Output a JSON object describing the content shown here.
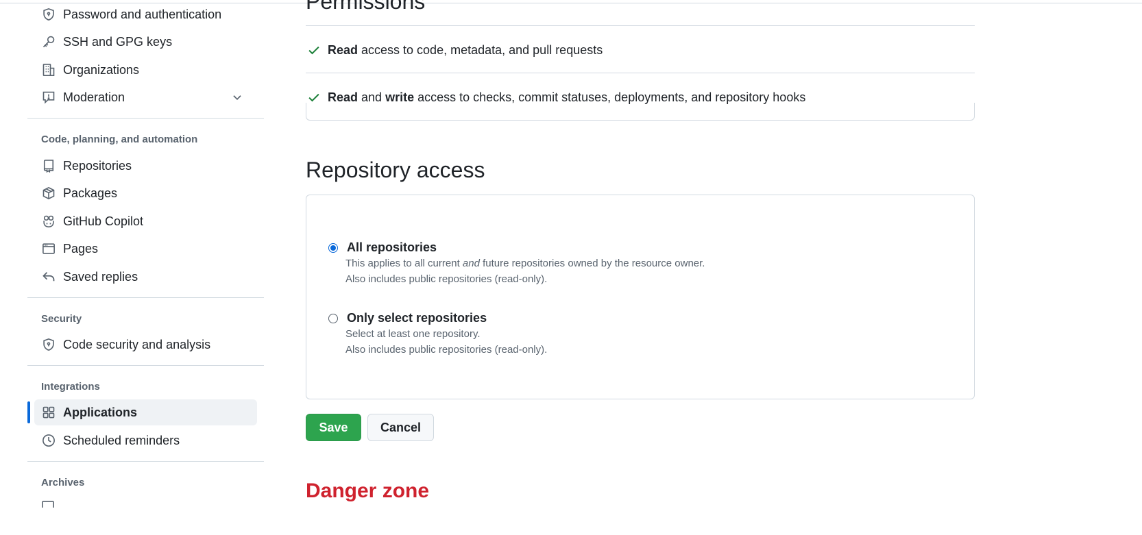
{
  "sidebar": {
    "items_top": [
      {
        "label": "Password and authentication",
        "icon": "shield-lock-icon"
      },
      {
        "label": "SSH and GPG keys",
        "icon": "key-icon"
      },
      {
        "label": "Organizations",
        "icon": "organization-icon"
      },
      {
        "label": "Moderation",
        "icon": "report-icon",
        "expandable": true
      }
    ],
    "sections": [
      {
        "title": "Code, planning, and automation",
        "items": [
          {
            "label": "Repositories",
            "icon": "repo-icon"
          },
          {
            "label": "Packages",
            "icon": "package-icon"
          },
          {
            "label": "GitHub Copilot",
            "icon": "copilot-icon"
          },
          {
            "label": "Pages",
            "icon": "browser-icon"
          },
          {
            "label": "Saved replies",
            "icon": "reply-icon"
          }
        ]
      },
      {
        "title": "Security",
        "items": [
          {
            "label": "Code security and analysis",
            "icon": "shield-lock-icon"
          }
        ]
      },
      {
        "title": "Integrations",
        "items": [
          {
            "label": "Applications",
            "icon": "apps-icon",
            "active": true
          },
          {
            "label": "Scheduled reminders",
            "icon": "clock-icon"
          }
        ]
      },
      {
        "title": "Archives",
        "items": []
      }
    ],
    "active_color": "#0969da"
  },
  "permissions": {
    "heading": "Permissions",
    "rows": [
      {
        "parts": [
          "Read",
          "access to code, metadata, and pull requests"
        ]
      },
      {
        "parts": [
          "Read",
          "and",
          "write",
          "access to checks, commit statuses, deployments, and repository hooks"
        ]
      }
    ]
  },
  "repository_access": {
    "heading": "Repository access",
    "options": [
      {
        "label": "All repositories",
        "checked": true,
        "desc1_pre": "This applies to all current",
        "desc1_em": "and",
        "desc1_post": "future repositories owned by the resource owner.",
        "desc2": "Also includes public repositories (read-only)."
      },
      {
        "label": "Only select repositories",
        "checked": false,
        "desc1": "Select at least one repository.",
        "desc2": "Also includes public repositories (read-only)."
      }
    ]
  },
  "buttons": {
    "save": "Save",
    "cancel": "Cancel",
    "save_color": "#2da44e"
  },
  "danger_zone": {
    "heading": "Danger zone",
    "color": "#cf222e"
  }
}
